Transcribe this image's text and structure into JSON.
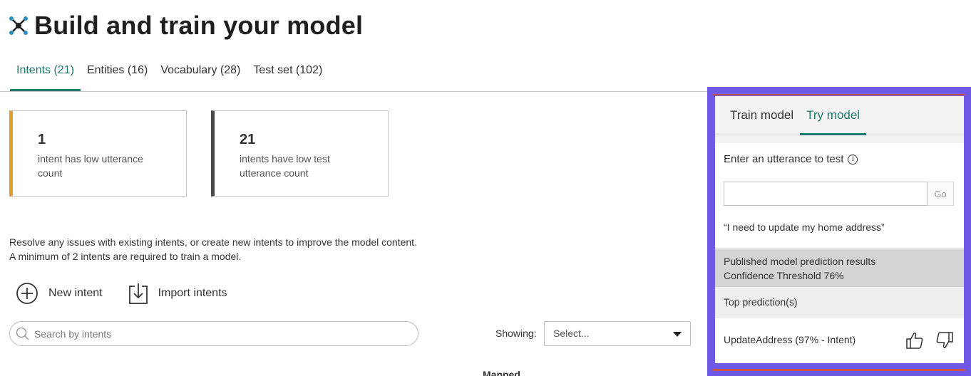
{
  "page": {
    "title": "Build and train your model",
    "logo_icon": "model-network-icon"
  },
  "tabs": [
    {
      "label": "Intents (21)",
      "active": true
    },
    {
      "label": "Entities (16)",
      "active": false
    },
    {
      "label": "Vocabulary (28)",
      "active": false
    },
    {
      "label": "Test set (102)",
      "active": false
    }
  ],
  "cards": [
    {
      "count": "1",
      "description": "intent has low utterance count",
      "accent": "#e0a02a"
    },
    {
      "count": "21",
      "description": "intents have low test utterance count",
      "accent": "#4a4a4a"
    }
  ],
  "info": {
    "line1": "Resolve any issues with existing intents, or create new intents to improve the model content.",
    "line2": "A minimum of 2 intents are required to train a model."
  },
  "actions": {
    "new_intent": "New intent",
    "import_intents": "Import intents"
  },
  "search": {
    "placeholder": "Search by intents"
  },
  "filter": {
    "label": "Showing:",
    "selected": "Select..."
  },
  "table": {
    "partial_header": "Mapped"
  },
  "panel": {
    "tabs": [
      {
        "label": "Train model",
        "active": false
      },
      {
        "label": "Try model",
        "active": true
      }
    ],
    "utterance_label": "Enter an utterance to test",
    "utterance_value": "",
    "go_label": "Go",
    "example_utterance": "“I need to update my home address”",
    "results_line1": "Published model prediction results",
    "results_line2": "Confidence Threshold 76%",
    "top_predictions_label": "Top prediction(s)",
    "prediction": "UpdateAddress (97% - Intent)"
  },
  "colors": {
    "accent": "#1f7a6e",
    "panel_highlight": "#6f5ae8"
  }
}
